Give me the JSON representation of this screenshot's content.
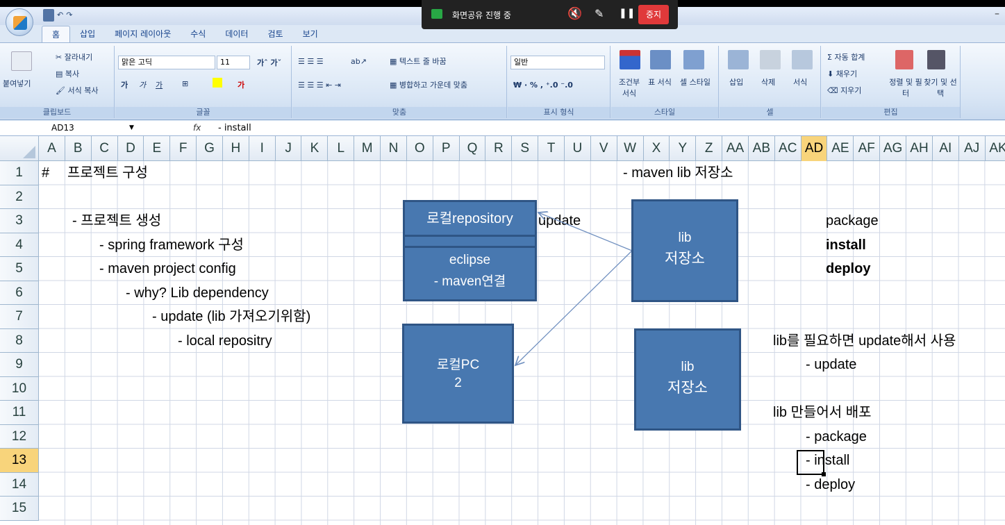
{
  "title_bar": {
    "qat_undo": "↶",
    "qat_redo": "↷",
    "minimize": "–"
  },
  "tabs": [
    "홈",
    "삽입",
    "페이지 레이아웃",
    "수식",
    "데이터",
    "검토",
    "보기"
  ],
  "share_bar": {
    "status": "화면공유 진행 중",
    "stop_label": "중지"
  },
  "ribbon": {
    "clipboard": {
      "paste": "붙여넣기",
      "cut": "잘라내기",
      "copy": "복사",
      "format_painter": "서식 복사",
      "label": "클립보드"
    },
    "font": {
      "font_name": "맑은 고딕",
      "font_size": "11",
      "label": "글꼴"
    },
    "alignment": {
      "wrap_text": "텍스트 줄 바꿈",
      "merge_center": "병합하고 가운데 맞춤",
      "label": "맞춤"
    },
    "number": {
      "format": "일반",
      "label": "표시 형식"
    },
    "styles": {
      "conditional": "조건부 서식",
      "table": "표 서식",
      "cell_style": "셀 스타일",
      "label": "스타일"
    },
    "cells": {
      "insert": "삽입",
      "delete": "삭제",
      "format": "서식",
      "label": "셀"
    },
    "editing": {
      "autosum": "자동 합계",
      "fill": "채우기",
      "clear": "지우기",
      "sort_filter": "정렬 및 필터",
      "find_select": "찾기 및 선택",
      "label": "편집"
    }
  },
  "formula_bar": {
    "name_box": "AD13",
    "fx": "fx",
    "formula": "- install"
  },
  "columns": [
    "A",
    "B",
    "C",
    "D",
    "E",
    "F",
    "G",
    "H",
    "I",
    "J",
    "K",
    "L",
    "M",
    "N",
    "O",
    "P",
    "Q",
    "R",
    "S",
    "T",
    "U",
    "V",
    "W",
    "X",
    "Y",
    "Z",
    "AA",
    "AB",
    "AC",
    "AD",
    "AE",
    "AF",
    "AG",
    "AH",
    "AI",
    "AJ",
    "AK"
  ],
  "selected_column": "AD",
  "rows": [
    "1",
    "2",
    "3",
    "4",
    "5",
    "6",
    "7",
    "8",
    "9",
    "10",
    "11",
    "12",
    "13",
    "14",
    "15"
  ],
  "selected_row": "13",
  "cells": {
    "a1": "#",
    "b1": "프로젝트 구성",
    "w1": "- maven lib 저장소",
    "c3": "- 프로젝트 생성",
    "d4": "- spring framework 구성",
    "d5": "- maven project config",
    "e6": "- why? Lib dependency",
    "f7": "- update (lib 가져오기위함)",
    "g8": "- local repositry",
    "u3": "update",
    "ae3": "package",
    "ae4": "install",
    "ae5": "deploy",
    "ac8": "lib를 필요하면 update해서 사용",
    "ad9": "- update",
    "ac11": "lib 만들어서 배포",
    "ad12": "- package",
    "ad13": "- install",
    "ad14": "- deploy"
  },
  "shapes": {
    "local_repo_title": "로컬repository",
    "local_repo_eclipse": "eclipse",
    "local_repo_maven": "- maven연결",
    "local_pc_line1": "로컬PC",
    "local_pc_line2": "2",
    "lib_store1_line1": "lib",
    "lib_store1_line2": "저장소",
    "lib_store2_line1": "lib",
    "lib_store2_line2": "저장소"
  },
  "colors": {
    "shape_fill": "#4878b0",
    "shape_border": "#2f5585",
    "selected_header": "#f8d47b",
    "stop_button": "#e0393a"
  }
}
